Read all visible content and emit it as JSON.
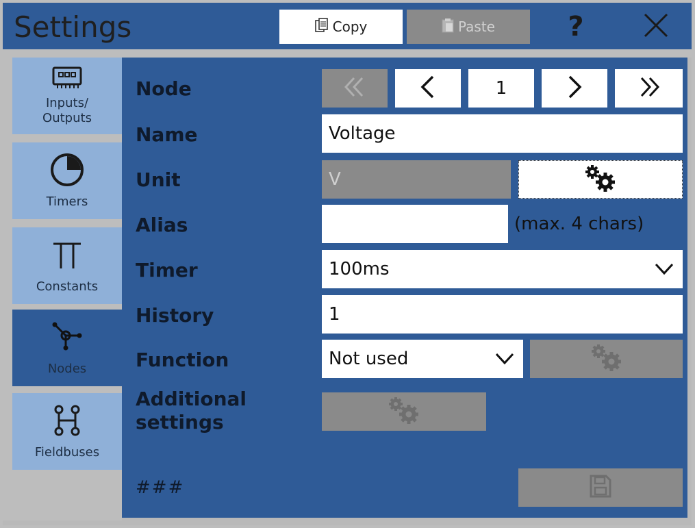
{
  "window": {
    "title": "Settings",
    "copy_label": "Copy",
    "paste_label": "Paste",
    "help_label": "?"
  },
  "sidebar": {
    "items": [
      {
        "label_line1": "Inputs/",
        "label_line2": "Outputs",
        "icon": "io-board-icon",
        "active": false
      },
      {
        "label_line1": "Timers",
        "label_line2": "",
        "icon": "timer-icon",
        "active": false
      },
      {
        "label_line1": "Constants",
        "label_line2": "",
        "icon": "pi-icon",
        "active": false
      },
      {
        "label_line1": "Nodes",
        "label_line2": "",
        "icon": "node-icon",
        "active": true
      },
      {
        "label_line1": "Fieldbuses",
        "label_line2": "",
        "icon": "fieldbus-icon",
        "active": false
      }
    ]
  },
  "form": {
    "node_label": "Node",
    "node_value": "1",
    "name_label": "Name",
    "name_value": "Voltage",
    "unit_label": "Unit",
    "unit_value": "V",
    "alias_label": "Alias",
    "alias_value": "",
    "alias_hint": "(max. 4 chars)",
    "timer_label": "Timer",
    "timer_value": "100ms",
    "history_label": "History",
    "history_value": "1",
    "function_label": "Function",
    "function_value": "Not used",
    "additional_label_line1": "Additional",
    "additional_label_line2": "settings",
    "footer_text": "###"
  },
  "colors": {
    "panel_blue": "#2f5b97",
    "sidebar_light": "#8fb0d8",
    "disabled_gray": "#8a8a8a",
    "background_gray": "#bdbdbd"
  }
}
